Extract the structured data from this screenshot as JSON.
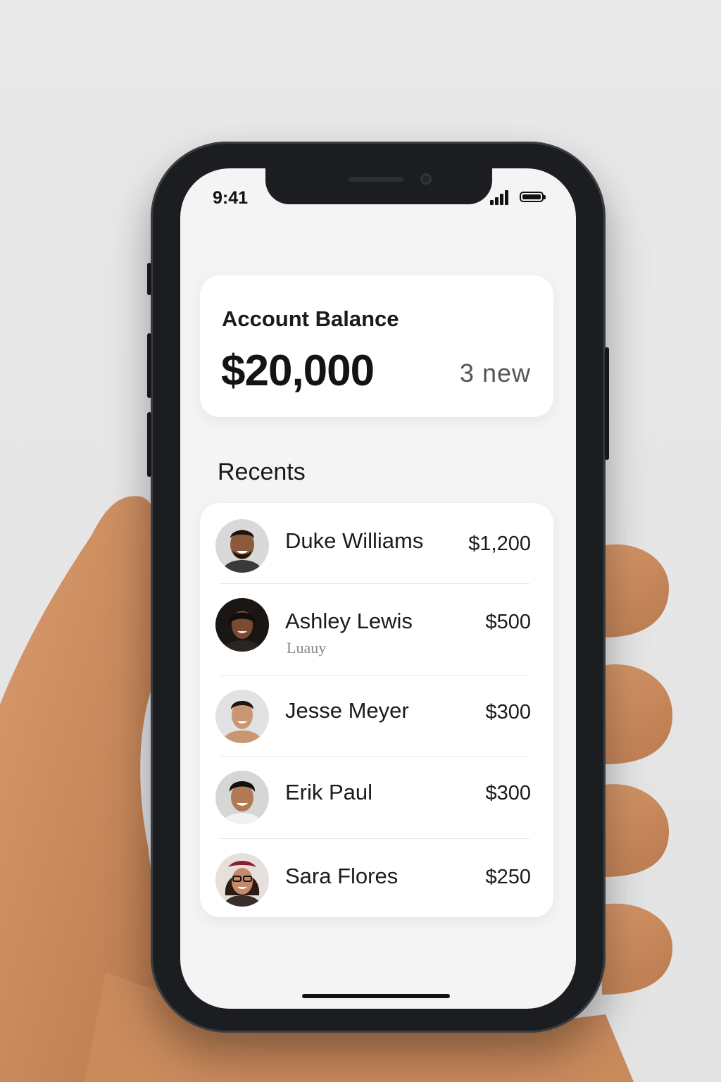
{
  "status_bar": {
    "time": "9:41"
  },
  "balance": {
    "title": "Account Balance",
    "amount": "$20,000",
    "new_label": "3 new"
  },
  "recents": {
    "heading": "Recents",
    "items": [
      {
        "name": "Duke Williams",
        "sub": "",
        "amount": "$1,200"
      },
      {
        "name": "Ashley Lewis",
        "sub": "Luauy",
        "amount": "$500"
      },
      {
        "name": "Jesse Meyer",
        "sub": "",
        "amount": "$300"
      },
      {
        "name": "Erik Paul",
        "sub": "",
        "amount": "$300"
      },
      {
        "name": "Sara Flores",
        "sub": "",
        "amount": "$250"
      }
    ]
  },
  "colors": {
    "background": "#e6e6e6",
    "phone": "#1b1d20",
    "screen": "#f4f4f4",
    "card": "#ffffff",
    "text": "#1b1b1b"
  }
}
